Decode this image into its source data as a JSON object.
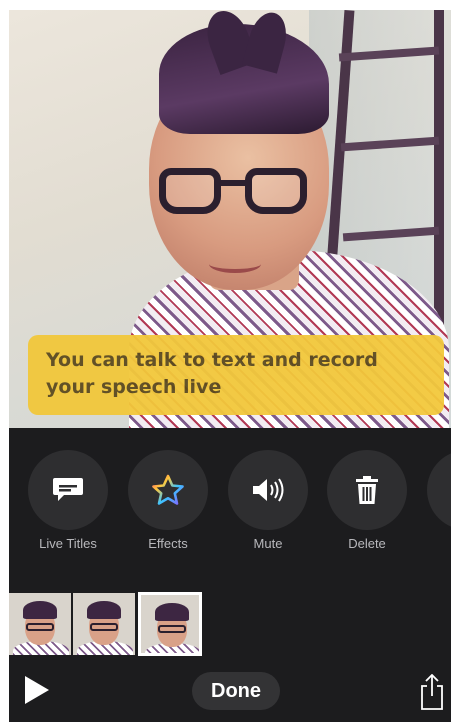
{
  "caption": {
    "text": "You can talk to text and record your speech live"
  },
  "tools": [
    {
      "label": "Live Titles",
      "icon": "speech-bubble-icon"
    },
    {
      "label": "Effects",
      "icon": "star-icon"
    },
    {
      "label": "Mute",
      "icon": "speaker-icon"
    },
    {
      "label": "Delete",
      "icon": "trash-icon"
    }
  ],
  "filmstrip": {
    "clips": 3,
    "selected_index": 2
  },
  "bottom_bar": {
    "done_label": "Done",
    "play_icon": "play-icon",
    "share_icon": "share-icon"
  },
  "colors": {
    "caption_bg": "#f2c83b",
    "panel_bg": "#1c1c1e",
    "tool_circle": "#2e2e30"
  }
}
